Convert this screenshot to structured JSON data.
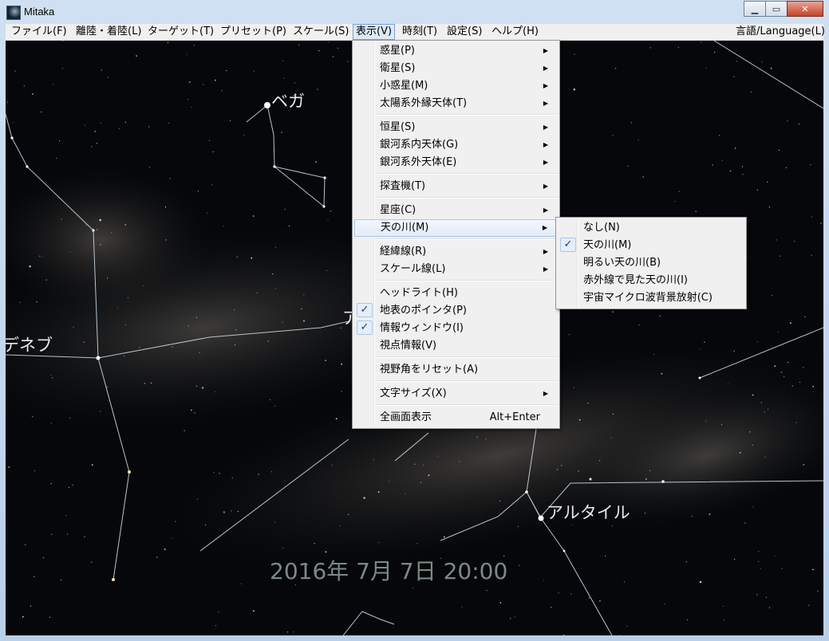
{
  "window": {
    "title": "Mitaka",
    "min_glyph": "▁",
    "max_glyph": "▭",
    "close_glyph": "✕"
  },
  "menubar": {
    "items": [
      "ファイル(F)",
      "離陸・着陸(L)",
      "ターゲット(T)",
      "プリセット(P)",
      "スケール(S)",
      "表示(V)",
      "時刻(T)",
      "設定(S)",
      "ヘルプ(H)"
    ],
    "language": "言語/Language(L)",
    "active": "表示(V)"
  },
  "view_menu": {
    "items": [
      {
        "label": "惑星(P)",
        "submenu": true
      },
      {
        "label": "衛星(S)",
        "submenu": true
      },
      {
        "label": "小惑星(M)",
        "submenu": true
      },
      {
        "label": "太陽系外縁天体(T)",
        "submenu": true
      },
      {
        "label": "恒星(S)",
        "submenu": true
      },
      {
        "label": "銀河系内天体(G)",
        "submenu": true
      },
      {
        "label": "銀河系外天体(E)",
        "submenu": true
      },
      {
        "label": "探査機(T)",
        "submenu": true
      },
      {
        "label": "星座(C)",
        "submenu": true
      },
      {
        "label": "天の川(M)",
        "submenu": true,
        "highlighted": true
      },
      {
        "label": "経緯線(R)",
        "submenu": true
      },
      {
        "label": "スケール線(L)",
        "submenu": true
      },
      {
        "label": "ヘッドライト(H)"
      },
      {
        "label": "地表のポインタ(P)",
        "checked": true
      },
      {
        "label": "情報ウィンドウ(I)",
        "checked": true
      },
      {
        "label": "視点情報(V)"
      },
      {
        "label": "視野角をリセット(A)"
      },
      {
        "label": "文字サイズ(X)",
        "submenu": true
      },
      {
        "label": "全画面表示",
        "shortcut": "Alt+Enter"
      }
    ],
    "arrow_glyph": "▶",
    "check_glyph": "✓"
  },
  "milkyway_submenu": {
    "items": [
      {
        "label": "なし(N)"
      },
      {
        "label": "天の川(M)",
        "checked": true
      },
      {
        "label": "明るい天の川(B)"
      },
      {
        "label": "赤外線で見た天の川(I)"
      },
      {
        "label": "宇宙マイクロ波背景放射(C)"
      }
    ]
  },
  "sky": {
    "labels": {
      "vega": "ベガ",
      "deneb": "デネブ",
      "altair": "アルタイル",
      "partial": "ア"
    },
    "datetime": "2016年 7月  7日   20:00"
  },
  "colors": {
    "sky": "#05070a",
    "constellation_line": "#b8c4d0",
    "menu_bg": "#f0f0f0",
    "highlight_border": "#a8c6ee"
  }
}
